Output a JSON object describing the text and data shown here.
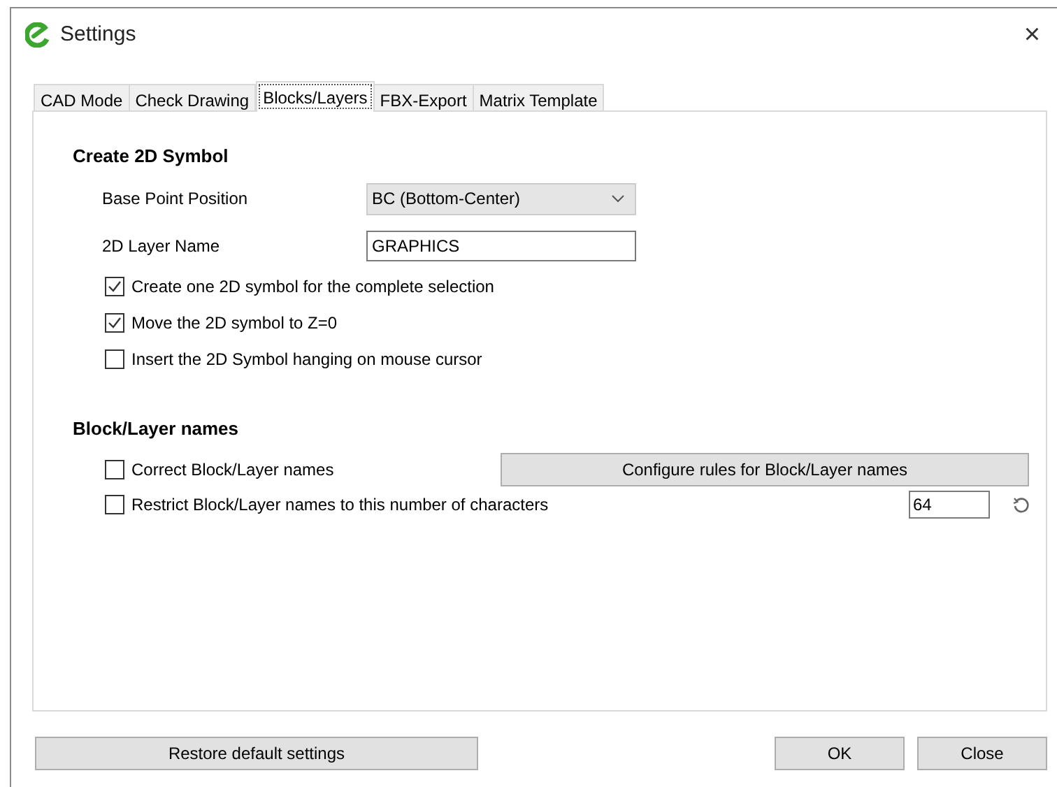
{
  "window": {
    "title": "Settings",
    "close": "×"
  },
  "tabs": [
    {
      "label": "CAD Mode",
      "selected": false
    },
    {
      "label": "Check Drawing",
      "selected": false
    },
    {
      "label": "Blocks/Layers",
      "selected": true
    },
    {
      "label": "FBX-Export",
      "selected": false
    },
    {
      "label": "Matrix Template",
      "selected": false
    }
  ],
  "create_2d_symbol": {
    "heading": "Create 2D Symbol",
    "base_point": {
      "label": "Base Point Position",
      "value": "BC (Bottom-Center)"
    },
    "layer_name": {
      "label": "2D Layer Name",
      "value": "GRAPHICS"
    },
    "options": [
      {
        "label": "Create one 2D symbol for the complete selection",
        "checked": true
      },
      {
        "label": "Move the 2D symbol to Z=0",
        "checked": true
      },
      {
        "label": "Insert the 2D Symbol hanging on mouse cursor",
        "checked": false
      }
    ]
  },
  "block_layer_names": {
    "heading": "Block/Layer names",
    "correct": {
      "label": "Correct Block/Layer names",
      "checked": false,
      "button": "Configure rules for Block/Layer names"
    },
    "restrict": {
      "label": "Restrict Block/Layer names to this number of characters",
      "checked": false,
      "value": "64"
    }
  },
  "buttons": {
    "restore": "Restore default settings",
    "ok": "OK",
    "close": "Close"
  }
}
